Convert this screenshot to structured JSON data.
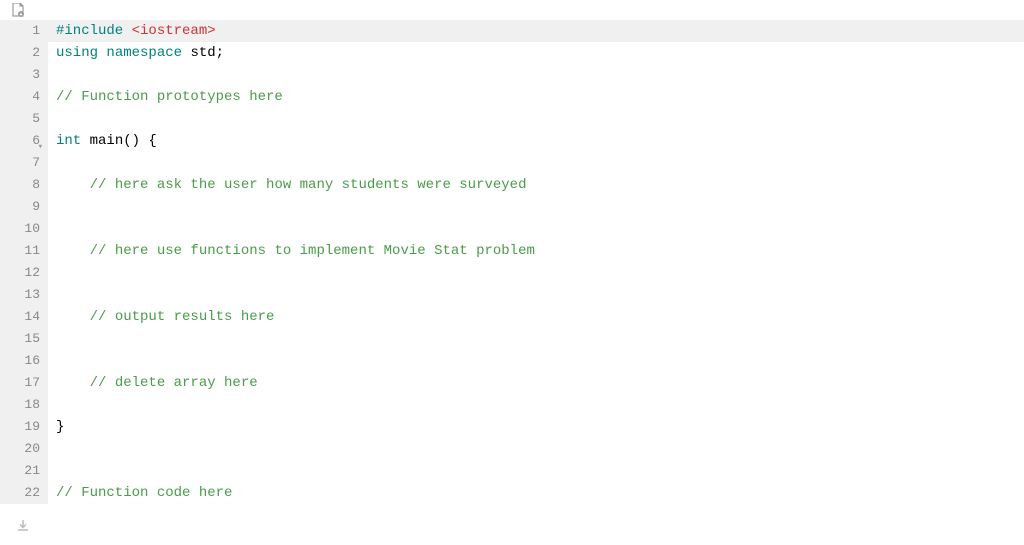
{
  "toolbar": {
    "fileIconName": "file-download-icon"
  },
  "gutter": {
    "numbers": [
      "1",
      "2",
      "3",
      "4",
      "5",
      "6",
      "7",
      "8",
      "9",
      "10",
      "11",
      "12",
      "13",
      "14",
      "15",
      "16",
      "17",
      "18",
      "19",
      "20",
      "21",
      "22"
    ],
    "foldAt": 6
  },
  "code": {
    "lines": [
      {
        "highlighted": true,
        "tokens": [
          {
            "cls": "tok-preproc",
            "text": "#include "
          },
          {
            "cls": "tok-include",
            "text": "<iostream>"
          }
        ],
        "indent": 0
      },
      {
        "tokens": [
          {
            "cls": "tok-keyword",
            "text": "using "
          },
          {
            "cls": "tok-keyword",
            "text": "namespace "
          },
          {
            "cls": "tok-ident",
            "text": "std"
          },
          {
            "cls": "tok-punc",
            "text": ";"
          }
        ],
        "indent": 0
      },
      {
        "tokens": [],
        "indent": 0
      },
      {
        "tokens": [
          {
            "cls": "tok-comment",
            "text": "// Function prototypes here"
          }
        ],
        "indent": 0
      },
      {
        "tokens": [],
        "indent": 0
      },
      {
        "tokens": [
          {
            "cls": "tok-keyword",
            "text": "int "
          },
          {
            "cls": "tok-ident",
            "text": "main"
          },
          {
            "cls": "tok-punc",
            "text": "() {"
          }
        ],
        "indent": 0
      },
      {
        "tokens": [],
        "indent": 0
      },
      {
        "tokens": [
          {
            "cls": "tok-comment",
            "text": "// here ask the user how many students were surveyed"
          }
        ],
        "indent": 2
      },
      {
        "tokens": [],
        "indent": 0
      },
      {
        "tokens": [],
        "indent": 0
      },
      {
        "tokens": [
          {
            "cls": "tok-comment",
            "text": "// here use functions to implement Movie Stat problem"
          }
        ],
        "indent": 2
      },
      {
        "tokens": [],
        "indent": 0
      },
      {
        "tokens": [],
        "indent": 0
      },
      {
        "tokens": [
          {
            "cls": "tok-comment",
            "text": "// output results here"
          }
        ],
        "indent": 2
      },
      {
        "tokens": [],
        "indent": 0
      },
      {
        "tokens": [],
        "indent": 0
      },
      {
        "tokens": [
          {
            "cls": "tok-comment",
            "text": "// delete array here"
          }
        ],
        "indent": 2
      },
      {
        "tokens": [],
        "indent": 0
      },
      {
        "tokens": [
          {
            "cls": "tok-punc",
            "text": "}"
          }
        ],
        "indent": 0
      },
      {
        "tokens": [],
        "indent": 0
      },
      {
        "tokens": [],
        "indent": 0
      },
      {
        "tokens": [
          {
            "cls": "tok-comment",
            "text": "// Function code here"
          }
        ],
        "indent": 0
      }
    ]
  }
}
